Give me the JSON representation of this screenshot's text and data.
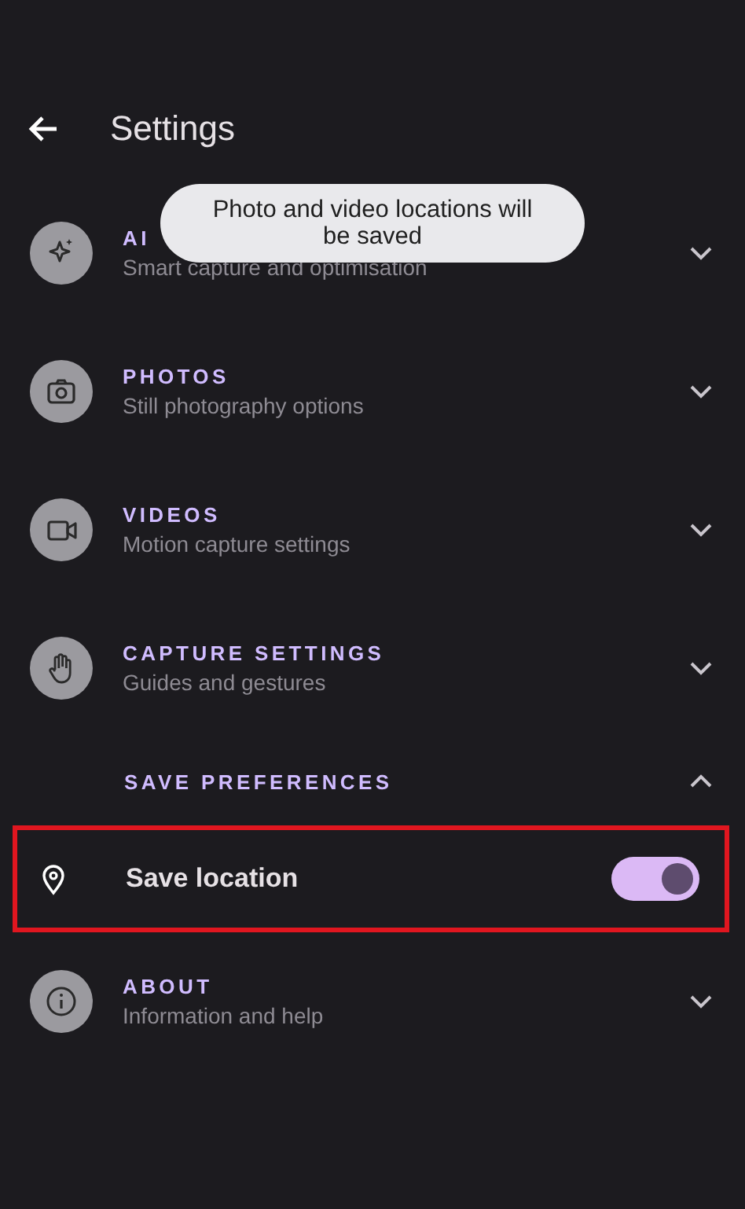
{
  "header": {
    "title": "Settings"
  },
  "toast": {
    "message": "Photo and video locations will be saved"
  },
  "sections": [
    {
      "kind": "category",
      "title": "AI",
      "subtitle": "Smart capture and optimisation",
      "expanded": false
    },
    {
      "kind": "category",
      "title": "PHOTOS",
      "subtitle": "Still photography options",
      "expanded": false
    },
    {
      "kind": "category",
      "title": "VIDEOS",
      "subtitle": "Motion capture settings",
      "expanded": false
    },
    {
      "kind": "category",
      "title": "CAPTURE SETTINGS",
      "subtitle": "Guides and gestures",
      "expanded": false
    },
    {
      "kind": "group",
      "title": "SAVE PREFERENCES",
      "expanded": true,
      "children": [
        {
          "label": "Save location",
          "on": true,
          "highlighted": true
        }
      ]
    },
    {
      "kind": "category",
      "title": "ABOUT",
      "subtitle": "Information and help",
      "expanded": false
    }
  ]
}
